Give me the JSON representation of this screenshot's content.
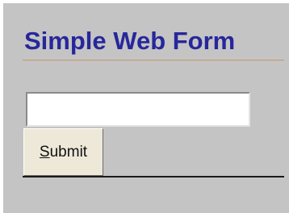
{
  "form": {
    "title": "Simple Web Form",
    "text_input": {
      "value": "",
      "placeholder": ""
    },
    "submit_button": {
      "access_key_letter": "S",
      "rest_label": "ubmit"
    }
  },
  "colors": {
    "background": "#c4c4c4",
    "title_text": "#27279b",
    "title_rule": "#c89467",
    "button_face": "#ede8d8"
  }
}
